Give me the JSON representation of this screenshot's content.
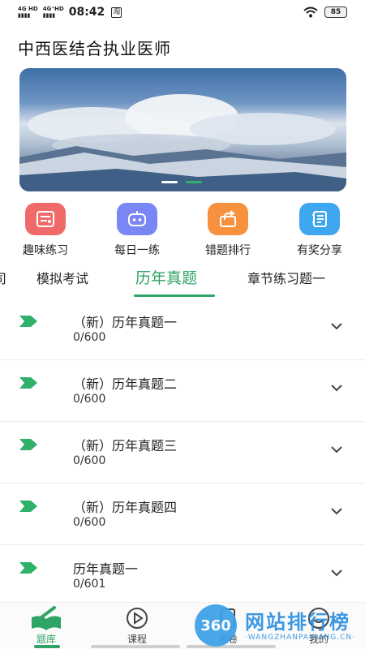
{
  "status_bar": {
    "signal1": "4G HD",
    "signal2": "4G+ HD",
    "time": "08:42",
    "tao_badge": "淘",
    "battery": "85"
  },
  "app": {
    "title": "中西医结合执业医师"
  },
  "banner": {
    "slides": 2,
    "active_slide": 2
  },
  "quick_actions": [
    {
      "label": "趣味练习",
      "icon": "quiz-sheet-icon",
      "color": "#f06a6a"
    },
    {
      "label": "每日一练",
      "icon": "robot-face-icon",
      "color": "#7b86f5"
    },
    {
      "label": "错题排行",
      "icon": "share-box-icon",
      "color": "#f7913d"
    },
    {
      "label": "有奖分享",
      "icon": "notebook-icon",
      "color": "#3fa6f0"
    }
  ],
  "tabs": {
    "partial_left": "司",
    "items": [
      "模拟考试",
      "历年真题",
      "章节练习题一"
    ],
    "active": "历年真题"
  },
  "papers": [
    {
      "title": "（新）历年真题一",
      "progress": "0/600"
    },
    {
      "title": "（新）历年真题二",
      "progress": "0/600"
    },
    {
      "title": "（新）历年真题三",
      "progress": "0/600"
    },
    {
      "title": "（新）历年真题四",
      "progress": "0/600"
    },
    {
      "title": "历年真题一",
      "progress": "0/601"
    }
  ],
  "bottom_nav": [
    {
      "label": "题库",
      "icon": "book-pen-icon",
      "active": true
    },
    {
      "label": "课程",
      "icon": "play-circle-icon",
      "active": false
    },
    {
      "label": "考卷",
      "icon": "exam-icon",
      "active": false
    },
    {
      "label": "我的",
      "icon": "profile-icon",
      "active": false
    }
  ],
  "watermark": {
    "badge": "360",
    "text": "网站排行榜",
    "sub": "·WANGZHANPAIHANG.CN·"
  },
  "colors": {
    "accent": "#2fa465",
    "flag": "#2fb16a"
  }
}
